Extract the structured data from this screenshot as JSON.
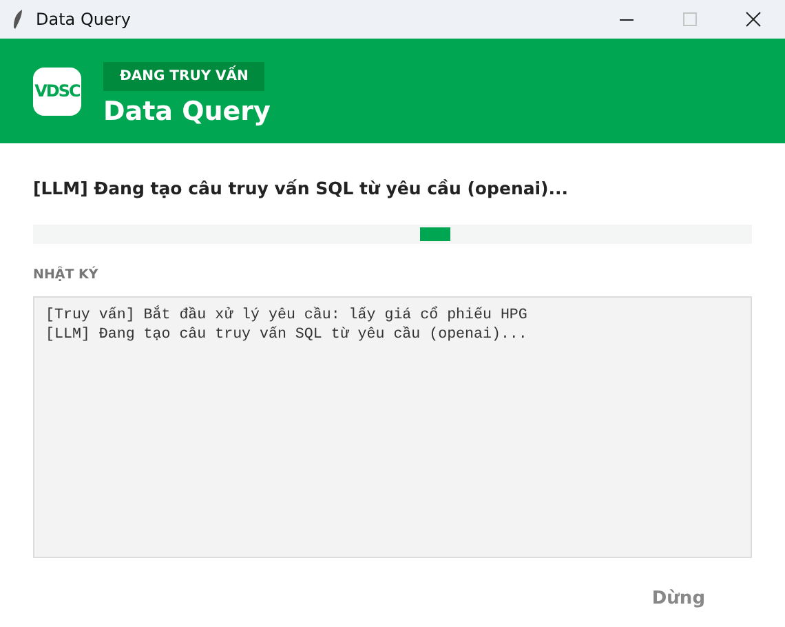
{
  "window": {
    "title": "Data Query",
    "maximize_disabled": true
  },
  "header": {
    "logo": "VDSC",
    "badge": "ĐANG TRUY VẤN",
    "title": "Data Query"
  },
  "status": "[LLM] Đang tạo câu truy vấn SQL từ yêu cầu (openai)...",
  "log": {
    "label": "NHẬT KÝ",
    "lines": [
      "[Truy vấn] Bắt đầu xử lý yêu cầu: lấy giá cổ phiếu HPG",
      "[LLM] Đang tạo câu truy vấn SQL từ yêu cầu (openai)..."
    ]
  },
  "buttons": [
    {
      "label": "Dừng",
      "disabled": true
    }
  ]
}
